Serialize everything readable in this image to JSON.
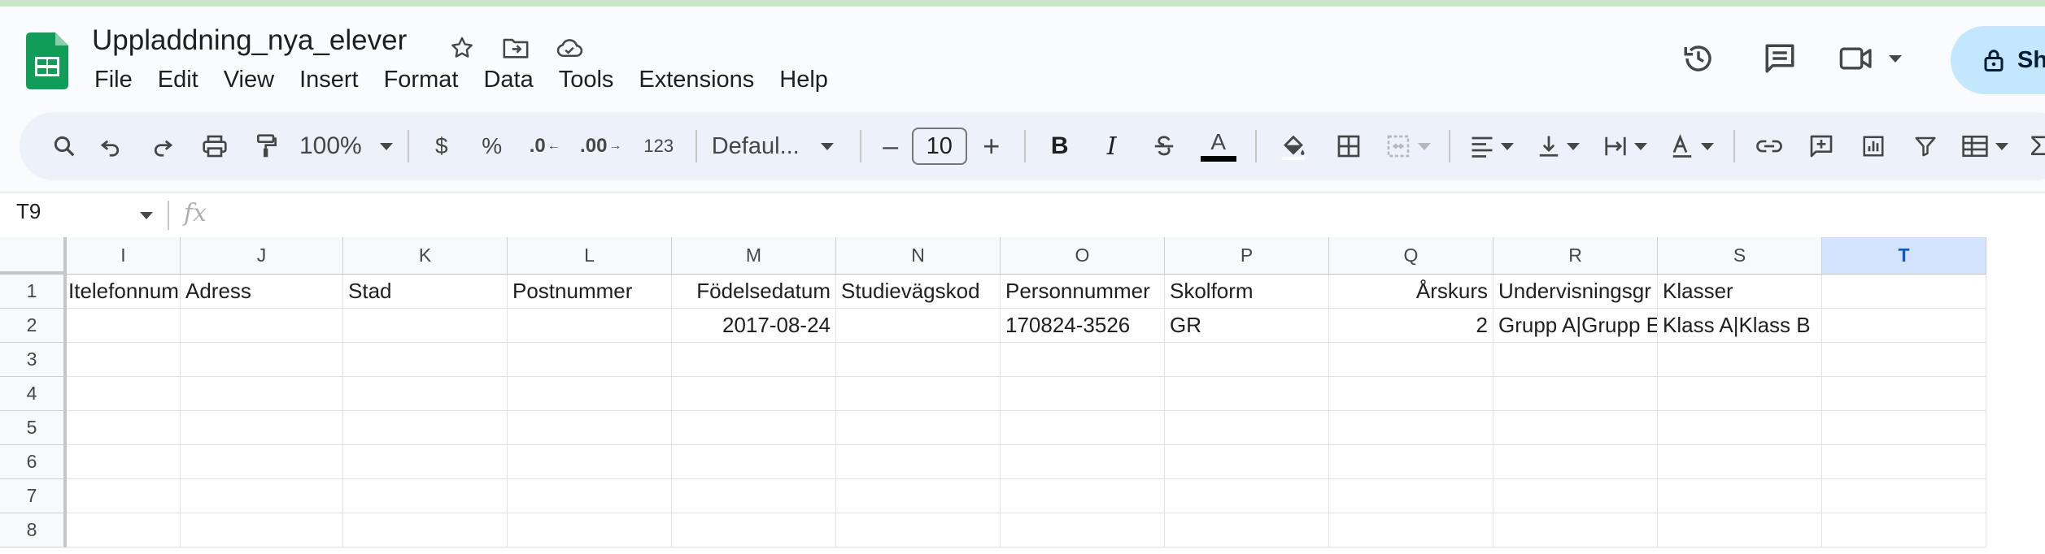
{
  "document": {
    "title": "Uppladdning_nya_elever"
  },
  "menu": [
    "File",
    "Edit",
    "View",
    "Insert",
    "Format",
    "Data",
    "Tools",
    "Extensions",
    "Help"
  ],
  "share": {
    "label": "Sh"
  },
  "toolbar": {
    "zoom": "100%",
    "currency": "$",
    "percent": "%",
    "dec_decrease": ".0",
    "dec_increase": ".00",
    "number_format": "123",
    "font": "Defaul...",
    "font_size": "10",
    "minus": "–",
    "plus": "+",
    "bold": "B",
    "italic": "I",
    "text_color": "A"
  },
  "formula_bar": {
    "cell_ref": "T9",
    "fx": "fx",
    "value": ""
  },
  "grid": {
    "columns": [
      "I",
      "J",
      "K",
      "L",
      "M",
      "N",
      "O",
      "P",
      "Q",
      "R",
      "S",
      "T"
    ],
    "selected_column": "T",
    "row_numbers": [
      "1",
      "2",
      "3",
      "4",
      "5",
      "6",
      "7",
      "8"
    ],
    "rows": [
      [
        "Itelefonnum",
        "Adress",
        "Stad",
        "Postnummer",
        "Födelsedatum",
        "Studievägskod",
        "Personnummer",
        "Skolform",
        "Årskurs",
        "Undervisningsgr",
        "Klasser",
        ""
      ],
      [
        "",
        "",
        "",
        "",
        "2017-08-24",
        "",
        "170824-3526",
        "GR",
        "2",
        "Grupp A|Grupp E",
        "Klass A|Klass B",
        ""
      ],
      [
        "",
        "",
        "",
        "",
        "",
        "",
        "",
        "",
        "",
        "",
        "",
        ""
      ],
      [
        "",
        "",
        "",
        "",
        "",
        "",
        "",
        "",
        "",
        "",
        "",
        ""
      ],
      [
        "",
        "",
        "",
        "",
        "",
        "",
        "",
        "",
        "",
        "",
        "",
        ""
      ],
      [
        "",
        "",
        "",
        "",
        "",
        "",
        "",
        "",
        "",
        "",
        "",
        ""
      ],
      [
        "",
        "",
        "",
        "",
        "",
        "",
        "",
        "",
        "",
        "",
        "",
        ""
      ],
      [
        "",
        "",
        "",
        "",
        "",
        "",
        "",
        "",
        "",
        "",
        "",
        ""
      ]
    ]
  }
}
